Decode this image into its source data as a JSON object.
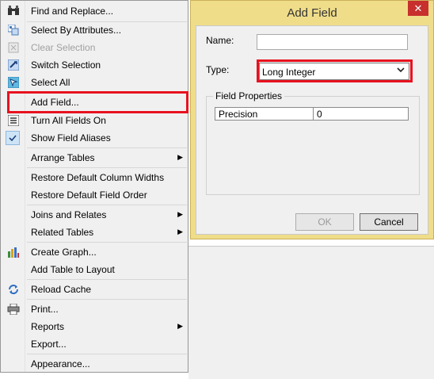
{
  "menu": {
    "items": [
      {
        "label": "Find and Replace...",
        "icon": "binoculars-icon"
      },
      {
        "label": "Select By Attributes...",
        "icon": "select-attributes-icon"
      },
      {
        "label": "Clear Selection",
        "icon": "clear-selection-icon",
        "disabled": true
      },
      {
        "label": "Switch Selection",
        "icon": "switch-selection-icon"
      },
      {
        "label": "Select All",
        "icon": "select-all-icon"
      },
      {
        "label": "Add Field...",
        "icon": ""
      },
      {
        "label": "Turn All Fields On",
        "icon": "fields-list-icon"
      },
      {
        "label": "Show Field Aliases",
        "icon": "checkmark-icon"
      },
      {
        "label": "Arrange Tables",
        "icon": ""
      },
      {
        "label": "Restore Default Column Widths",
        "icon": ""
      },
      {
        "label": "Restore Default Field Order",
        "icon": ""
      },
      {
        "label": "Joins and Relates",
        "icon": ""
      },
      {
        "label": "Related Tables",
        "icon": ""
      },
      {
        "label": "Create Graph...",
        "icon": "bar-chart-icon"
      },
      {
        "label": "Add Table to Layout",
        "icon": ""
      },
      {
        "label": "Reload Cache",
        "icon": "refresh-icon"
      },
      {
        "label": "Print...",
        "icon": "printer-icon"
      },
      {
        "label": "Reports",
        "icon": ""
      },
      {
        "label": "Export...",
        "icon": ""
      },
      {
        "label": "Appearance...",
        "icon": ""
      }
    ],
    "submenu_arrow": "▶"
  },
  "dialog": {
    "title": "Add Field",
    "close_glyph": "✕",
    "name_label": "Name:",
    "name_value": "",
    "type_label": "Type:",
    "type_value": "Long Integer",
    "field_properties_legend": "Field Properties",
    "properties": [
      {
        "key": "Precision",
        "value": "0"
      }
    ],
    "ok_label": "OK",
    "cancel_label": "Cancel"
  },
  "colors": {
    "highlight": "#e8121f",
    "dialog_frame": "#f0dd8a",
    "close_button": "#c7302d"
  }
}
